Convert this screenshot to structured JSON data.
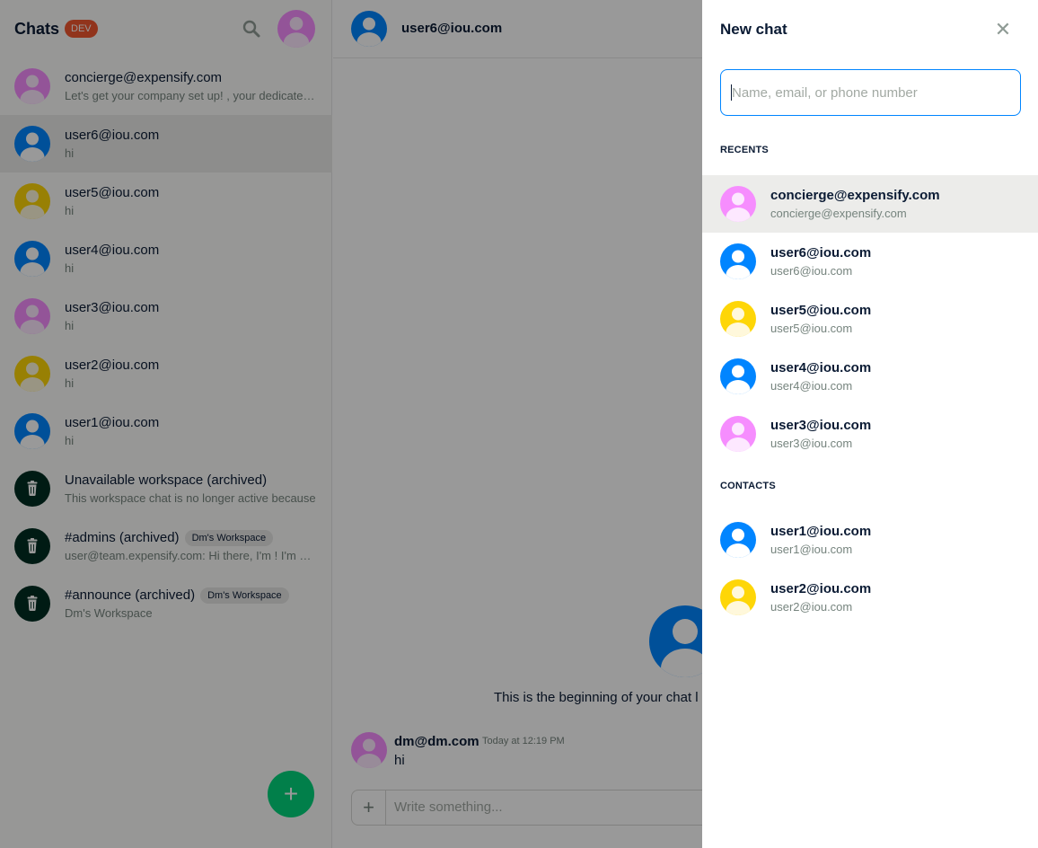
{
  "sidebar": {
    "title": "Chats",
    "env_badge": "DEV",
    "search_icon": "search-icon",
    "new_button_icon": "plus-icon",
    "chats": [
      {
        "name": "concierge@expensify.com",
        "preview": "Let's get your company set up! , your dedicated setup specialist",
        "avatar": "pink",
        "active": false
      },
      {
        "name": "user6@iou.com",
        "preview": "hi",
        "avatar": "blue",
        "active": true
      },
      {
        "name": "user5@iou.com",
        "preview": "hi",
        "avatar": "yellow",
        "active": false
      },
      {
        "name": "user4@iou.com",
        "preview": "hi",
        "avatar": "blue",
        "active": false
      },
      {
        "name": "user3@iou.com",
        "preview": "hi",
        "avatar": "pink",
        "active": false
      },
      {
        "name": "user2@iou.com",
        "preview": "hi",
        "avatar": "yellow",
        "active": false
      },
      {
        "name": "user1@iou.com",
        "preview": "hi",
        "avatar": "blue",
        "active": false
      },
      {
        "name": "Unavailable workspace (archived)",
        "preview": "This workspace chat is no longer active because",
        "avatar": "trash",
        "active": false
      },
      {
        "name": "#admins (archived)",
        "badge": "Dm's Workspace",
        "preview": "user@team.expensify.com: Hi there, I'm ! I'm here to help",
        "avatar": "trash",
        "active": false
      },
      {
        "name": "#announce (archived)",
        "badge": "Dm's Workspace",
        "preview": "Dm's Workspace",
        "avatar": "trash",
        "active": false
      }
    ]
  },
  "chat": {
    "header_title": "user6@iou.com",
    "beginning_text": "This is the beginning of your chat l",
    "message": {
      "author": "dm@dm.com",
      "time": "Today at 12:19 PM",
      "text": "hi"
    },
    "composer_placeholder": "Write something..."
  },
  "new_chat": {
    "title": "New chat",
    "close_icon": "close-icon",
    "search_placeholder": "Name, email, or phone number",
    "recents_label": "RECENTS",
    "recents": [
      {
        "name": "concierge@expensify.com",
        "sub": "concierge@expensify.com",
        "avatar": "pink",
        "selected": true
      },
      {
        "name": "user6@iou.com",
        "sub": "user6@iou.com",
        "avatar": "blue"
      },
      {
        "name": "user5@iou.com",
        "sub": "user5@iou.com",
        "avatar": "yellow"
      },
      {
        "name": "user4@iou.com",
        "sub": "user4@iou.com",
        "avatar": "blue"
      },
      {
        "name": "user3@iou.com",
        "sub": "user3@iou.com",
        "avatar": "pink"
      }
    ],
    "contacts_label": "CONTACTS",
    "contacts": [
      {
        "name": "user1@iou.com",
        "sub": "user1@iou.com",
        "avatar": "blue"
      },
      {
        "name": "user2@iou.com",
        "sub": "user2@iou.com",
        "avatar": "yellow"
      }
    ]
  },
  "colors": {
    "accent_green": "#03d47c",
    "focus_blue": "#0185ff",
    "dev_badge": "#f25730",
    "avatar_pink": [
      "#f68dfe",
      "#fde8ff"
    ],
    "avatar_blue": [
      "#0185ff",
      "#ffffff"
    ],
    "avatar_yellow": [
      "#fed607",
      "#fff8db"
    ],
    "avatar_trash": [
      "#002e22",
      "#ffffff"
    ]
  }
}
